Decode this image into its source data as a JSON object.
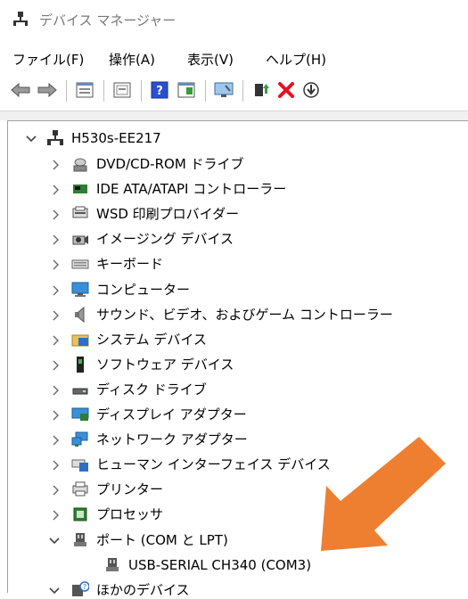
{
  "window": {
    "title": "デバイス マネージャー"
  },
  "menu": [
    "ファイル(F)",
    "操作(A)",
    "表示(V)",
    "ヘルプ(H)"
  ],
  "toolbar": {
    "buttons": [
      "back-icon",
      "forward-icon",
      "properties-icon",
      "device-list-icon",
      "help-icon",
      "view-icon",
      "monitor-icon",
      "add-driver-icon",
      "uninstall-icon",
      "download-icon"
    ]
  },
  "tree": {
    "root": "H530s-EE217",
    "categories": [
      {
        "label": "DVD/CD-ROM ドライブ",
        "icon": "dvd-icon",
        "expanded": false
      },
      {
        "label": "IDE ATA/ATAPI コントローラー",
        "icon": "ide-controller-icon",
        "expanded": false
      },
      {
        "label": "WSD 印刷プロバイダー",
        "icon": "print-provider-icon",
        "expanded": false
      },
      {
        "label": "イメージング デバイス",
        "icon": "camera-icon",
        "expanded": false
      },
      {
        "label": "キーボード",
        "icon": "keyboard-icon",
        "expanded": false
      },
      {
        "label": "コンピューター",
        "icon": "computer-icon",
        "expanded": false
      },
      {
        "label": "サウンド、ビデオ、およびゲーム コントローラー",
        "icon": "speaker-icon",
        "expanded": false
      },
      {
        "label": "システム デバイス",
        "icon": "system-folder-icon",
        "expanded": false
      },
      {
        "label": "ソフトウェア デバイス",
        "icon": "software-device-icon",
        "expanded": false
      },
      {
        "label": "ディスク ドライブ",
        "icon": "disk-drive-icon",
        "expanded": false
      },
      {
        "label": "ディスプレイ アダプター",
        "icon": "display-adapter-icon",
        "expanded": false
      },
      {
        "label": "ネットワーク アダプター",
        "icon": "network-adapter-icon",
        "expanded": false
      },
      {
        "label": "ヒューマン インターフェイス デバイス",
        "icon": "hid-icon",
        "expanded": false
      },
      {
        "label": "プリンター",
        "icon": "printer-icon",
        "expanded": false
      },
      {
        "label": "プロセッサ",
        "icon": "processor-icon",
        "expanded": false
      },
      {
        "label": "ポート (COM と LPT)",
        "icon": "port-icon",
        "expanded": true
      },
      {
        "label": "USB-SERIAL CH340 (COM3)",
        "icon": "port-icon",
        "child": true
      },
      {
        "label": "ほかのデバイス",
        "icon": "other-device-icon",
        "expanded": true
      }
    ]
  },
  "colors": {
    "highlight_arrow": "#ef7f30",
    "error_x": "#e81123",
    "help_blue": "#2a4fd0"
  }
}
